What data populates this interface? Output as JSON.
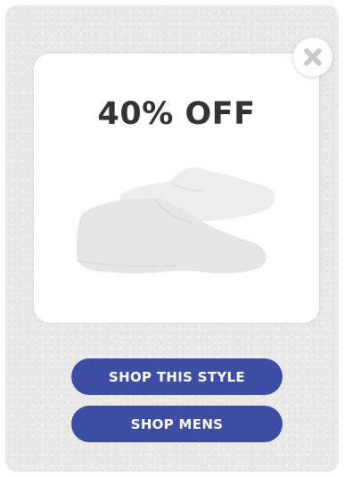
{
  "promo": {
    "headline": "40% OFF",
    "image_icon": "shoe-icon"
  },
  "close": {
    "icon": "close-icon"
  },
  "buttons": {
    "shop_style": "SHOP THIS STYLE",
    "shop_mens": "SHOP MENS"
  },
  "colors": {
    "button_bg": "#3d4da4",
    "button_text": "#ffffff",
    "headline": "#333333",
    "popup_bg": "#e9e9ea",
    "card_bg": "#ffffff"
  }
}
